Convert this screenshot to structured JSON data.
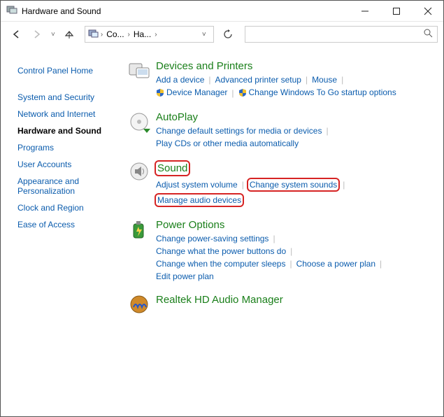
{
  "window": {
    "title": "Hardware and Sound"
  },
  "breadcrumb": {
    "seg1": "Co...",
    "seg2": "Ha..."
  },
  "search": {
    "placeholder": ""
  },
  "sidebar": {
    "home": "Control Panel Home",
    "items": [
      "System and Security",
      "Network and Internet",
      "Hardware and Sound",
      "Programs",
      "User Accounts",
      "Appearance and Personalization",
      "Clock and Region",
      "Ease of Access"
    ],
    "active_index": 2
  },
  "categories": [
    {
      "key": "devices",
      "title": "Devices and Printers",
      "tasks": [
        {
          "label": "Add a device"
        },
        {
          "label": "Advanced printer setup"
        },
        {
          "label": "Mouse"
        },
        {
          "label": "Device Manager",
          "shield": true
        },
        {
          "label": "Change Windows To Go startup options",
          "shield": true
        }
      ]
    },
    {
      "key": "autoplay",
      "title": "AutoPlay",
      "tasks": [
        {
          "label": "Change default settings for media or devices"
        },
        {
          "label": "Play CDs or other media automatically"
        }
      ]
    },
    {
      "key": "sound",
      "title": "Sound",
      "title_highlight": true,
      "tasks": [
        {
          "label": "Adjust system volume"
        },
        {
          "label": "Change system sounds",
          "highlight": true
        },
        {
          "label": "Manage audio devices",
          "highlight": true
        }
      ]
    },
    {
      "key": "power",
      "title": "Power Options",
      "tasks": [
        {
          "label": "Change power-saving settings"
        },
        {
          "label": "Change what the power buttons do"
        },
        {
          "label": "Change when the computer sleeps"
        },
        {
          "label": "Choose a power plan"
        },
        {
          "label": "Edit power plan"
        }
      ]
    },
    {
      "key": "realtek",
      "title": "Realtek HD Audio Manager",
      "tasks": []
    }
  ]
}
